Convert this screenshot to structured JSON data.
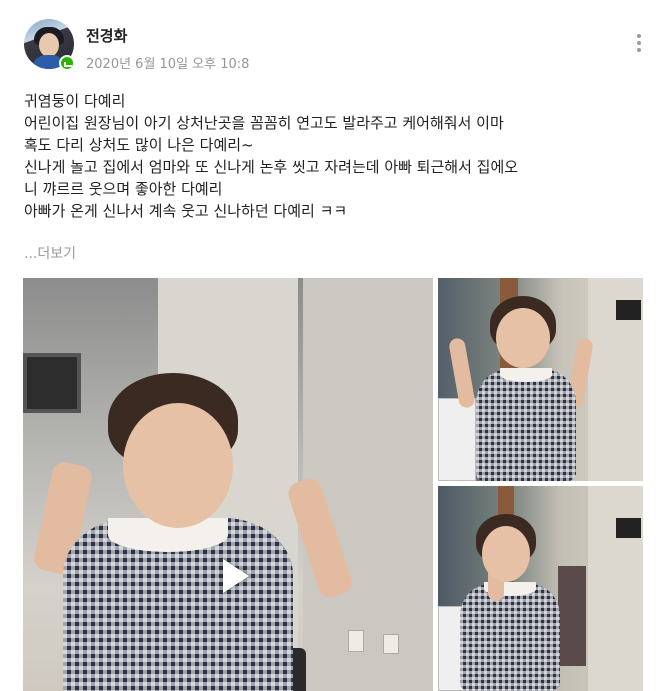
{
  "author": {
    "name": "전경화",
    "date": "2020년 6월 10일 오후 10:8"
  },
  "post": {
    "lines": [
      "귀염둥이 다예리",
      "어린이집 원장님이 아기 상처난곳을 꼼꼼히 연고도 발라주고 케어해줘서 이마",
      "혹도 다리 상처도 많이 나은 다예리~",
      "신나게 놀고 집에서 엄마와 또 신나게 논후 씻고 자려는데 아빠 퇴근해서 집에오",
      "니 꺄르르 웃으며 좋아한 다예리",
      "아빠가 온게 신나서 계속 웃고 신나하던 다예리 ㅋㅋ"
    ],
    "read_more": "...더보기"
  },
  "icons": {
    "menu": "more-vertical-icon",
    "badge": "verified-badge-icon",
    "play": "play-icon"
  },
  "colors": {
    "accent_green": "#2db400",
    "meta_gray": "#979797"
  }
}
